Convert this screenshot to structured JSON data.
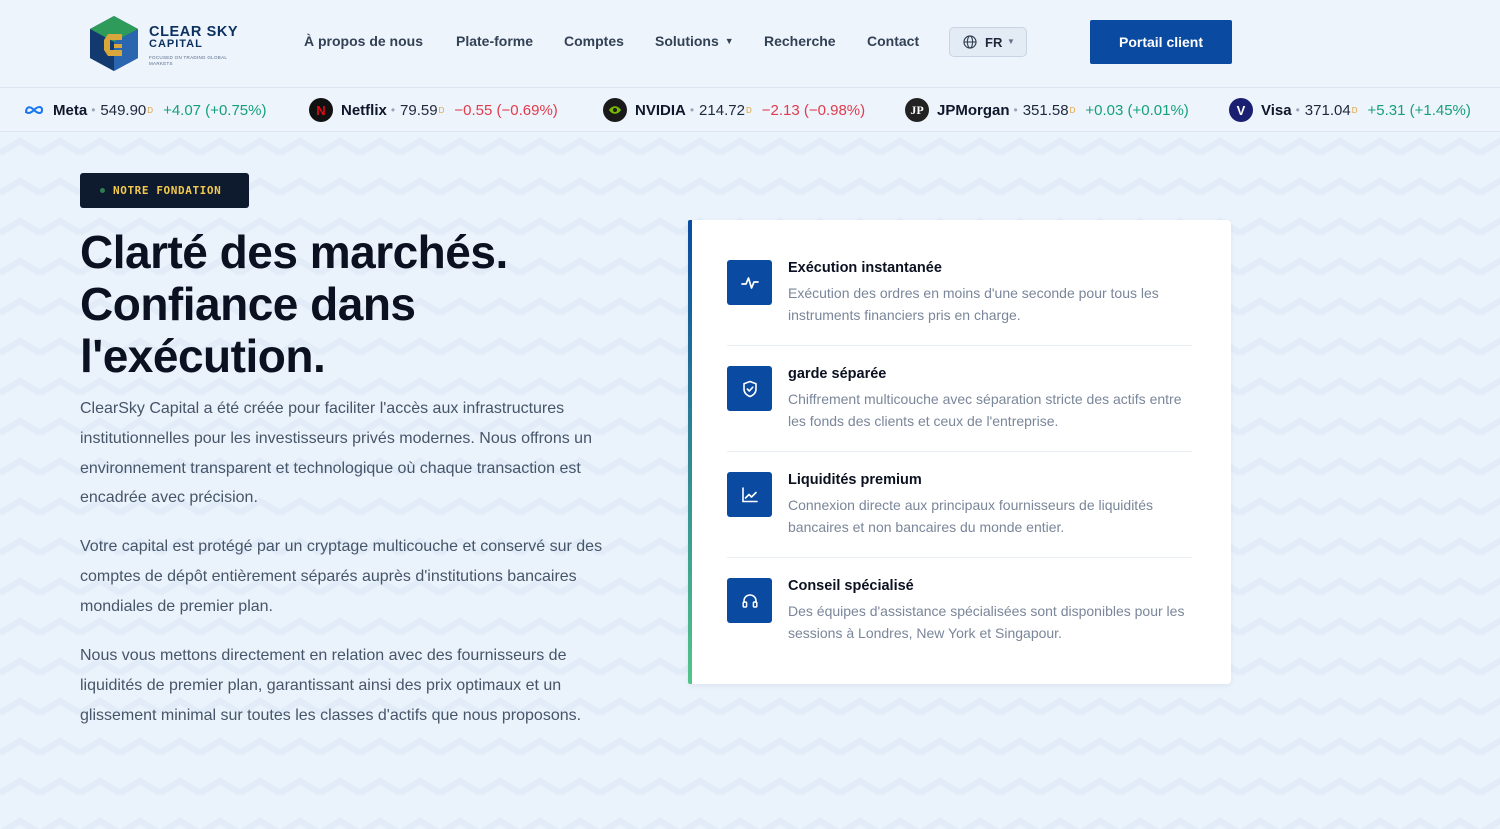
{
  "brand": {
    "name_line1": "CLEAR SKY",
    "name_line2": "CAPITAL",
    "tagline": "FOCUSED ON TRADING GLOBAL MARKETS"
  },
  "nav": {
    "items": [
      {
        "label": "À propos de nous"
      },
      {
        "label": "Plate-forme"
      },
      {
        "label": "Comptes"
      },
      {
        "label": "Solutions"
      },
      {
        "label": "Recherche"
      },
      {
        "label": "Contact"
      }
    ],
    "language": "FR",
    "portal_label": "Portail client"
  },
  "ticker": [
    {
      "name": "Meta",
      "price": "549.90",
      "change": "+4.07 (+0.75%)",
      "direction": "up",
      "icon": "meta-icon"
    },
    {
      "name": "Netflix",
      "price": "79.59",
      "change": "−0.55 (−0.69%)",
      "direction": "down",
      "icon": "netflix-icon"
    },
    {
      "name": "NVIDIA",
      "price": "214.72",
      "change": "−2.13 (−0.98%)",
      "direction": "down",
      "icon": "nvidia-icon"
    },
    {
      "name": "JPMorgan",
      "price": "351.58",
      "change": "+0.03 (+0.01%)",
      "direction": "up",
      "icon": "jpmorgan-icon"
    },
    {
      "name": "Visa",
      "price": "371.04",
      "change": "+5.31 (+1.45%)",
      "direction": "up",
      "icon": "visa-icon"
    }
  ],
  "ticker_marker": "D",
  "hero": {
    "badge": "NOTRE FONDATION",
    "title_lines": [
      "Clarté des marchés.",
      "Confiance dans",
      "l'exécution."
    ],
    "paragraphs": [
      "ClearSky Capital a été créée pour faciliter l'accès aux infrastructures institutionnelles pour les investisseurs privés modernes. Nous offrons un environnement transparent et technologique où chaque transaction est encadrée avec précision.",
      "Votre capital est protégé par un cryptage multicouche et conservé sur des comptes de dépôt entièrement séparés auprès d'institutions bancaires mondiales de premier plan.",
      "Nous vous mettons directement en relation avec des fournisseurs de liquidités de premier plan, garantissant ainsi des prix optimaux et un glissement minimal sur toutes les classes d'actifs que nous proposons."
    ]
  },
  "features": [
    {
      "title": "Exécution instantanée",
      "desc": "Exécution des ordres en moins d'une seconde pour tous les instruments financiers pris en charge.",
      "icon": "activity-icon"
    },
    {
      "title": "garde séparée",
      "desc": "Chiffrement multicouche avec séparation stricte des actifs entre les fonds des clients et ceux de l'entreprise.",
      "icon": "shield-check-icon"
    },
    {
      "title": "Liquidités premium",
      "desc": "Connexion directe aux principaux fournisseurs de liquidités bancaires et non bancaires du monde entier.",
      "icon": "line-chart-icon"
    },
    {
      "title": "Conseil spécialisé",
      "desc": "Des équipes d'assistance spécialisées sont disponibles pour les sessions à Londres, New York et Singapour.",
      "icon": "headset-icon"
    }
  ],
  "colors": {
    "primary": "#0a4aa0",
    "up": "#16a077",
    "down": "#e23b4b",
    "badge_text": "#f2c94c",
    "dark": "#0e1a2e"
  }
}
